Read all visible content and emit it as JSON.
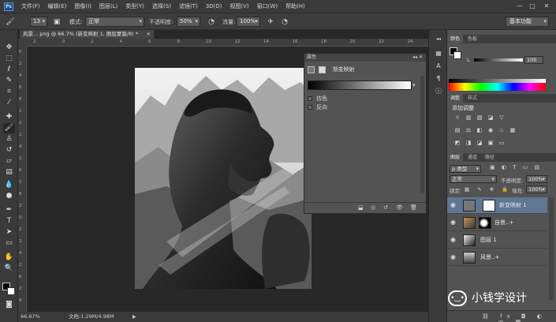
{
  "menubar": {
    "logo": "Ps",
    "items": [
      "文件(F)",
      "编辑(E)",
      "图像(I)",
      "图层(L)",
      "类型(Y)",
      "选择(S)",
      "滤镜(T)",
      "3D(D)",
      "视图(V)",
      "窗口(W)",
      "帮助(H)"
    ],
    "min": "—",
    "max": "□",
    "close": "✕"
  },
  "options": {
    "brush_size": "13",
    "mode_label": "模式:",
    "mode_value": "正常",
    "opacity_label": "不透明度:",
    "opacity_value": "50%",
    "flow_label": "流量:",
    "flow_value": "100%",
    "workspace": "基本功能"
  },
  "document": {
    "tab_title": "风景... png @ 66.7% (新变映射 1, 图层蒙版/8) *",
    "tab_close": "×",
    "ruler_top": [
      "2",
      "0",
      "2",
      "4",
      "6",
      "8",
      "10",
      "12",
      "14",
      "16",
      "18",
      "20",
      "22",
      "24"
    ],
    "ruler_left": [
      "0",
      "2",
      "4",
      "6",
      "8",
      "1",
      "2",
      "1",
      "4",
      "1",
      "6",
      "1",
      "8",
      "2",
      "0",
      "2",
      "2",
      "4",
      "2",
      "6",
      "2",
      "8"
    ]
  },
  "status": {
    "zoom": "66.67%",
    "doc": "文档:1.29M/4.98M"
  },
  "properties": {
    "title": "属性",
    "adjustment": "渐变映射",
    "dither": "仿色",
    "reverse": "反向"
  },
  "right": {
    "color_tabs": [
      "颜色",
      "色板"
    ],
    "color_value": "100",
    "adjust_tabs": [
      "调整",
      "样式"
    ],
    "add_adjustment": "添加调整",
    "layer_tabs": [
      "图层",
      "通道",
      "路径"
    ],
    "kind_label": "ρ 类型",
    "blend_mode": "正常",
    "opacity_label": "不透明度:",
    "opacity_value": "100%",
    "lock_label": "锁定:",
    "fill_label": "填充:",
    "fill_value": "100%",
    "layers": [
      {
        "name": "新变映射 1",
        "selected": true
      },
      {
        "name": "自景..+",
        "selected": false
      },
      {
        "name": "图层 1",
        "selected": false
      },
      {
        "name": "风景..+",
        "selected": false
      }
    ]
  },
  "watermark": {
    "text": "小钱学设计"
  },
  "colors": {
    "selected_layer": "#5f7694",
    "panel": "#535353"
  }
}
